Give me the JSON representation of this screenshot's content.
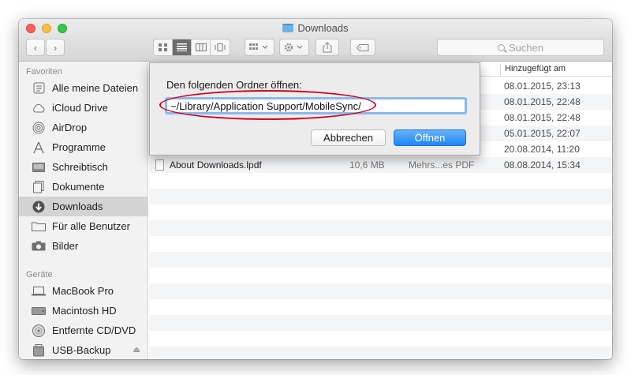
{
  "window": {
    "title": "Downloads"
  },
  "toolbar": {
    "back": "‹",
    "forward": "›",
    "search_placeholder": "Suchen"
  },
  "sidebar": {
    "favorites_heading": "Favoriten",
    "favorites": [
      {
        "label": "Alle meine Dateien",
        "icon": "all-files-icon"
      },
      {
        "label": "iCloud Drive",
        "icon": "cloud-icon"
      },
      {
        "label": "AirDrop",
        "icon": "airdrop-icon"
      },
      {
        "label": "Programme",
        "icon": "applications-icon"
      },
      {
        "label": "Schreibtisch",
        "icon": "desktop-icon"
      },
      {
        "label": "Dokumente",
        "icon": "documents-icon"
      },
      {
        "label": "Downloads",
        "icon": "downloads-icon",
        "selected": true
      },
      {
        "label": "Für alle Benutzer",
        "icon": "folder-icon"
      },
      {
        "label": "Bilder",
        "icon": "camera-icon"
      }
    ],
    "devices_heading": "Geräte",
    "devices": [
      {
        "label": "MacBook Pro",
        "icon": "laptop-icon"
      },
      {
        "label": "Macintosh HD",
        "icon": "harddisk-icon"
      },
      {
        "label": "Entfernte CD/DVD",
        "icon": "disc-icon"
      },
      {
        "label": "USB-Backup",
        "icon": "usb-drive-icon",
        "eject": "⏏"
      }
    ]
  },
  "list": {
    "column_added": "Hinzugefügt am",
    "rows": [
      {
        "date": "08.01.2015, 23:13"
      },
      {
        "date": "08.01.2015, 22:48"
      },
      {
        "date": "08.01.2015, 22:48"
      },
      {
        "date": "05.01.2015, 22:07"
      },
      {
        "date": "20.08.2014, 11:20"
      },
      {
        "name": "About Downloads.lpdf",
        "size": "10,6 MB",
        "kind": "Mehrs...es PDF",
        "date": "08.08.2014, 15:34"
      }
    ]
  },
  "dialog": {
    "label": "Den folgenden Ordner öffnen:",
    "path_value": "~/Library/Application Support/MobileSync/",
    "cancel_label": "Abbrechen",
    "open_label": "Öffnen"
  },
  "colors": {
    "accent": "#1b87f5",
    "highlight": "#d0021b",
    "selection": "#d3d3d3"
  }
}
